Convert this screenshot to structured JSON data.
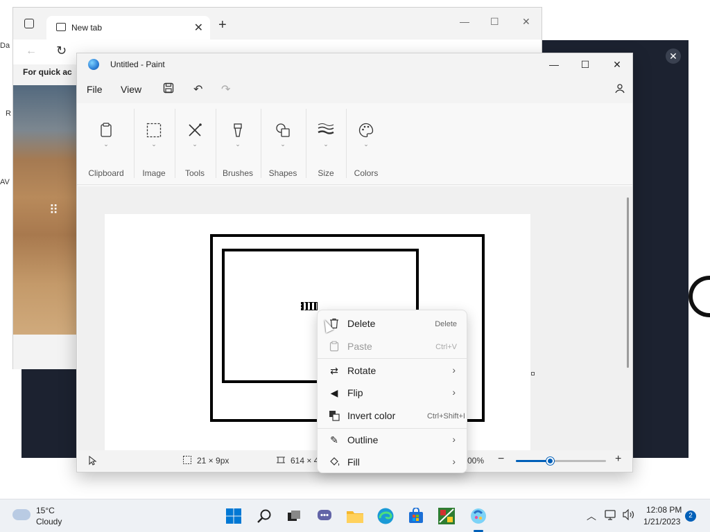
{
  "desktop": {
    "left_labels": [
      "Da",
      "R",
      "AV"
    ],
    "dark_close_icon": "close-icon"
  },
  "edge": {
    "tab_title": "New tab",
    "quick_access_text": "For quick ac"
  },
  "paint": {
    "window_title": "Untitled - Paint",
    "menu": {
      "file": "File",
      "view": "View"
    },
    "ribbon": [
      {
        "label": "Clipboard",
        "icon": "clipboard-icon"
      },
      {
        "label": "Image",
        "icon": "selection-icon"
      },
      {
        "label": "Tools",
        "icon": "tools-icon"
      },
      {
        "label": "Brushes",
        "icon": "brush-icon"
      },
      {
        "label": "Shapes",
        "icon": "shapes-icon"
      },
      {
        "label": "Size",
        "icon": "size-icon"
      },
      {
        "label": "Colors",
        "icon": "palette-icon"
      }
    ],
    "status": {
      "selection_size": "21 × 9px",
      "canvas_size": "614 × 4",
      "zoom": "00%",
      "zoom_level": 0.38
    }
  },
  "context_menu": {
    "items": [
      {
        "label": "Delete",
        "shortcut": "Delete",
        "disabled": false,
        "submenu": false
      },
      {
        "label": "Paste",
        "shortcut": "Ctrl+V",
        "disabled": true,
        "submenu": false
      },
      {
        "label": "Rotate",
        "shortcut": "",
        "disabled": false,
        "submenu": true
      },
      {
        "label": "Flip",
        "shortcut": "",
        "disabled": false,
        "submenu": true
      },
      {
        "label": "Invert color",
        "shortcut": "Ctrl+Shift+I",
        "disabled": false,
        "submenu": false
      },
      {
        "label": "Outline",
        "shortcut": "",
        "disabled": false,
        "submenu": true
      },
      {
        "label": "Fill",
        "shortcut": "",
        "disabled": false,
        "submenu": true
      }
    ]
  },
  "taskbar": {
    "weather_temp": "15°C",
    "weather_condition": "Cloudy",
    "time": "12:08 PM",
    "date": "1/21/2023",
    "notification_count": "2"
  },
  "colors": {
    "accent": "#005fb8",
    "dark_window": "#1c2230"
  }
}
